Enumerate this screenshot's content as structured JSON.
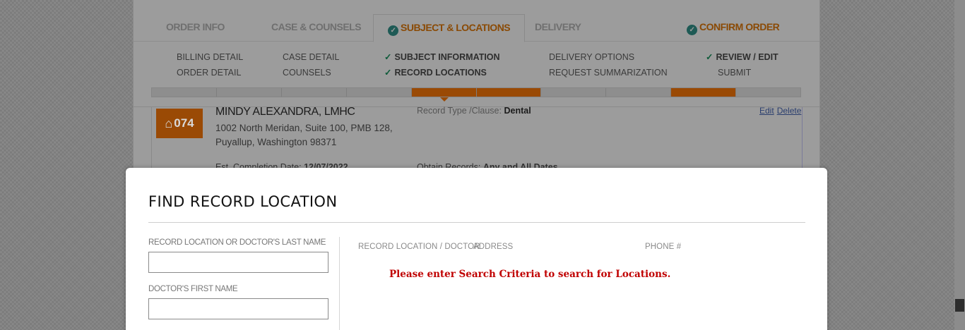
{
  "tabs": {
    "order_info": "ORDER INFO",
    "case_counsels": "CASE & COUNSELS",
    "subject_locations": "SUBJECT & LOCATIONS",
    "delivery": "DELIVERY",
    "confirm_order": "CONFIRM ORDER"
  },
  "subnav": {
    "billing_detail": "BILLING DETAIL",
    "order_detail": "ORDER DETAIL",
    "case_detail": "CASE DETAIL",
    "counsels": "COUNSELS",
    "subject_information": "SUBJECT INFORMATION",
    "record_locations": "RECORD LOCATIONS",
    "delivery_options": "DELIVERY OPTIONS",
    "request_summarization": "REQUEST SUMMARIZATION",
    "review_edit": "REVIEW / EDIT",
    "submit": "SUBMIT"
  },
  "location_card": {
    "badge_number": "074",
    "name": "MINDY ALEXANDRA, LMHC",
    "address_line1": "1002 North Meridan, Suite 100, PMB 128,",
    "address_line2": "Puyallup, Washington 98371",
    "record_type_label": "Record Type /Clause:",
    "record_type_value": "Dental",
    "edit_link": "Edit",
    "delete_link": "Delete",
    "est_completion_label": "Est. Completion Date:",
    "est_completion_value": "12/07/2022",
    "obtain_records_label": "Obtain Records:",
    "obtain_records_value": "Any and All Dates"
  },
  "modal": {
    "title": "FIND RECORD LOCATION",
    "last_name_label": "RECORD LOCATION OR DOCTOR'S LAST NAME",
    "last_name_value": "",
    "first_name_label": "DOCTOR'S FIRST NAME",
    "first_name_value": "",
    "col_location": "RECORD LOCATION / DOCTOR",
    "col_address": "ADDRESS",
    "col_phone": "PHONE #",
    "message": "Please enter Search Criteria to search for Locations."
  },
  "colors": {
    "accent": "#f47b00",
    "check": "#1a9a6e",
    "error": "#c00000"
  }
}
